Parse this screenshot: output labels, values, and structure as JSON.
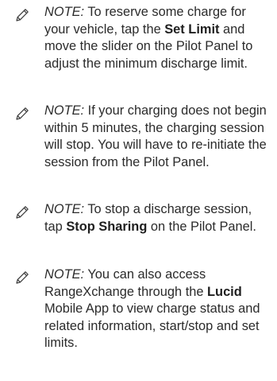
{
  "notes": [
    {
      "icon": "pencil-icon",
      "label": "NOTE:",
      "text_1": " To reserve some charge for your vehicle, tap the ",
      "bold_1": "Set Limit",
      "text_2": " and move the slider on the Pilot Panel to adjust the minimum discharge limit."
    },
    {
      "icon": "pencil-icon",
      "label": "NOTE:",
      "text_1": " If your charging does not begin within 5 minutes, the charging session will stop. You will have to re-initiate the session from the Pilot Panel."
    },
    {
      "icon": "pencil-icon",
      "label": "NOTE:",
      "text_1": " To stop a discharge session, tap ",
      "bold_1": "Stop Sharing",
      "text_2": " on the Pilot Panel."
    },
    {
      "icon": "pencil-icon",
      "label": "NOTE:",
      "text_1": " You can also access RangeXchange through the ",
      "bold_1": "Lucid",
      "text_2": " Mobile App to view charge status and related information, start/stop and set limits."
    }
  ]
}
